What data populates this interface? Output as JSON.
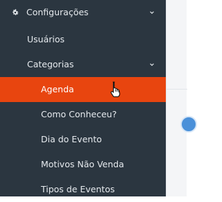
{
  "sidebar": {
    "section": {
      "label": "Configurações",
      "icon": "gear-icon",
      "expanded": true
    },
    "items": [
      {
        "label": "Usuários"
      },
      {
        "label": "Categorias",
        "expanded": true
      }
    ],
    "sub_items": [
      {
        "label": "Agenda",
        "active": true
      },
      {
        "label": "Como Conheceu?"
      },
      {
        "label": "Dia do Evento"
      },
      {
        "label": "Motivos Não Venda"
      },
      {
        "label": "Tipos de Eventos"
      }
    ],
    "colors": {
      "background": "#2b3640",
      "active": "#e8450f",
      "text": "#e6eaee"
    }
  }
}
